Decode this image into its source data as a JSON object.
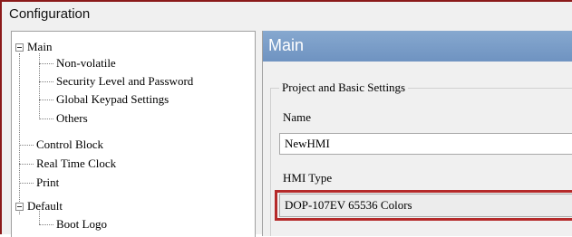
{
  "window": {
    "title": "Configuration"
  },
  "tree": {
    "main": "Main",
    "non_volatile": "Non-volatile",
    "security": "Security Level and Password",
    "keypad": "Global Keypad Settings",
    "others": "Others",
    "control_block": "Control Block",
    "real_time_clock": "Real Time Clock",
    "print": "Print",
    "default": "Default",
    "boot_logo": "Boot Logo"
  },
  "panel": {
    "header": "Main",
    "group_title": "Project and Basic Settings",
    "name_label": "Name",
    "name_value": "NewHMI",
    "hmi_type_label": "HMI Type",
    "hmi_type_value": "DOP-107EV 65536 Colors"
  },
  "colors": {
    "panel_header": "#7a9dc9",
    "highlight": "#b52a2a",
    "frame": "#8b1a1a"
  }
}
